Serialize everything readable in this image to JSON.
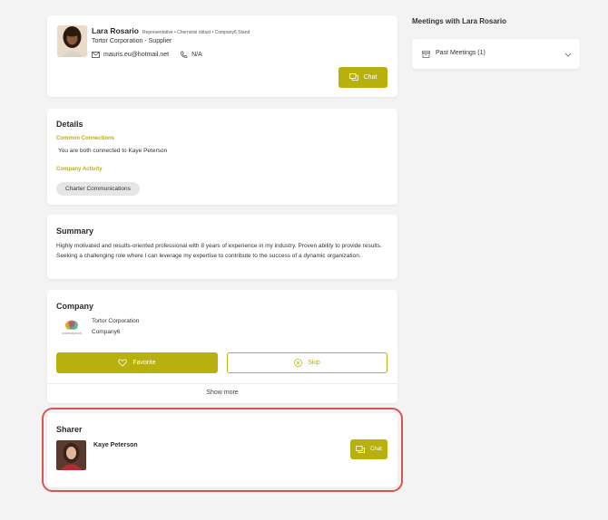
{
  "profile": {
    "name": "Lara Rosario",
    "roles": "Representative • Chernivtsi oblast • Company6 Stand",
    "organization": "Tortor Corporation - Supplier",
    "email": "mauris.eu@hotmail.net",
    "phone": "N/A",
    "chat_label": "Chat"
  },
  "details": {
    "title": "Details",
    "common_connections_label": "Common Connections",
    "common_connections_text": "You are both connected to Kaye Peterson",
    "company_activity_label": "Company Activity",
    "activity_tag": "Charter Communications"
  },
  "summary": {
    "title": "Summary",
    "text": "Highly motivated and results-oriented professional with 8 years of experience in my industry. Proven ability to provide results. Seeking a challenging role where I can leverage my expertise to contribute to the success of a dynamic organization."
  },
  "company": {
    "title": "Company",
    "name": "Tortor Corporation",
    "sub": "Company6",
    "logo_text": "CORPORATION",
    "favorite_label": "Favorite",
    "skip_label": "Skip",
    "show_more_label": "Show more"
  },
  "sharer": {
    "title": "Sharer",
    "name": "Kaye Peterson",
    "chat_label": "Chat"
  },
  "meetings": {
    "title": "Meetings with Lara Rosario",
    "past_label": "Past Meetings (1)"
  },
  "colors": {
    "accent": "#b8b00c",
    "highlight": "#d9534f",
    "background": "#f3f3f3"
  }
}
